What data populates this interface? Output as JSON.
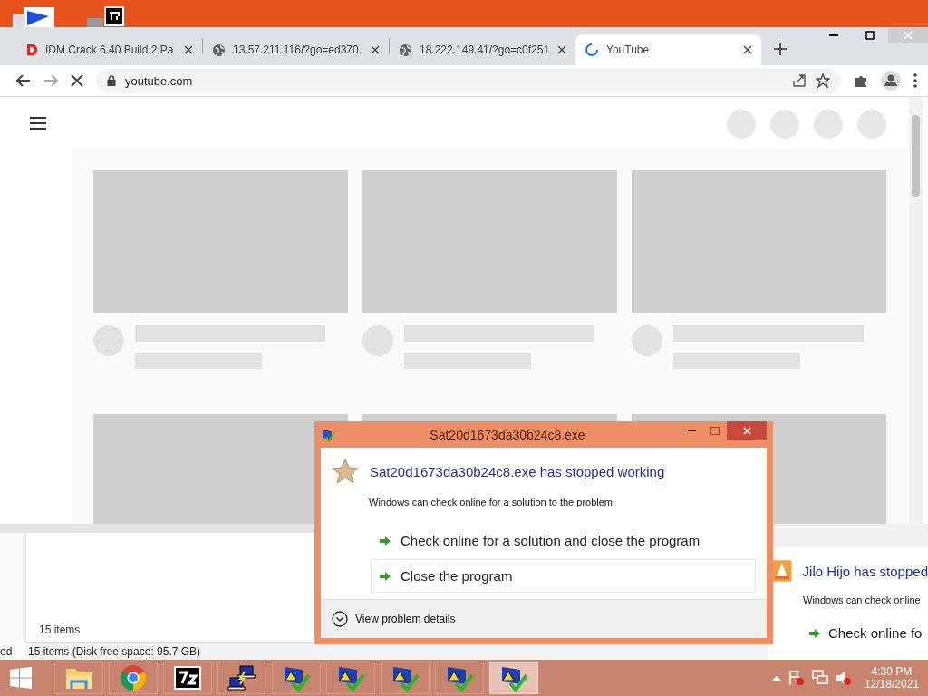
{
  "browser": {
    "tabs": [
      {
        "title": "IDM Crack 6.40 Build 2 Pa",
        "kind": "idm",
        "selected": false
      },
      {
        "title": "13.57.211.116/?go=ed370",
        "kind": "globe",
        "selected": false
      },
      {
        "title": "18.222.149.41/?go=c0f251",
        "kind": "globe",
        "selected": false
      },
      {
        "title": "YouTube",
        "kind": "loading",
        "selected": true
      }
    ],
    "address": "youtube.com"
  },
  "explorer": {
    "pane_text": "ed",
    "items_label": "15 items",
    "status": "15 items (Disk free space: 95.7 GB)"
  },
  "error_dialog": {
    "window_title": "Sat20d1673da30b24c8.exe",
    "heading": "Sat20d1673da30b24c8.exe has stopped working",
    "message": "Windows can check online for a solution to the problem.",
    "options": [
      {
        "label": "Check online for a solution and close the program",
        "selected": false
      },
      {
        "label": "Close the program",
        "selected": true
      }
    ],
    "details": "View problem details"
  },
  "second_dialog": {
    "heading": "Jilo Hijo has stopped",
    "message": "Windows can check online",
    "option": "Check online fo"
  },
  "taskbar": {
    "apps": [
      {
        "kind": "explorer",
        "selected": false
      },
      {
        "kind": "chrome",
        "selected": false
      },
      {
        "kind": "sevenzip",
        "selected": false
      },
      {
        "kind": "network",
        "selected": false
      },
      {
        "kind": "warning",
        "selected": false
      },
      {
        "kind": "warning",
        "selected": false
      },
      {
        "kind": "warning",
        "selected": false
      },
      {
        "kind": "warning",
        "selected": false
      },
      {
        "kind": "warning",
        "selected": true
      }
    ],
    "time": "4:30 PM",
    "date": "12/18/2021"
  }
}
